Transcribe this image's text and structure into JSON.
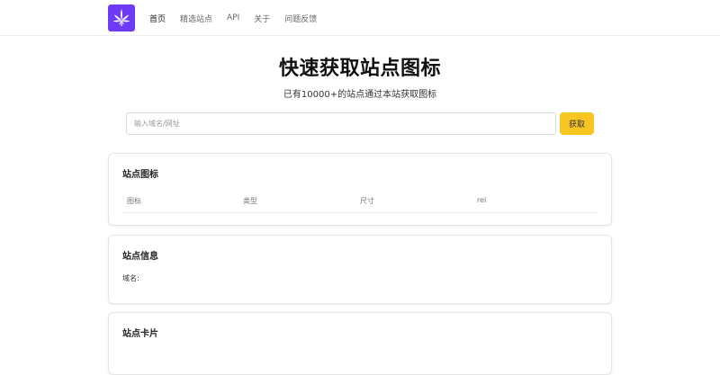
{
  "nav": {
    "logo_icon": "cannabis-leaf-icon",
    "logo_color": "#6d3bf5",
    "links": [
      "首页",
      "精选站点",
      "API",
      "关于",
      "问题反馈"
    ],
    "active_index": 0
  },
  "hero": {
    "title": "快速获取站点图标",
    "subtitle": "已有10000+的站点通过本站获取图标"
  },
  "search": {
    "placeholder": "输入域名/网址",
    "value": "",
    "button_label": "获取",
    "button_color": "#f7c623"
  },
  "icons_card": {
    "title": "站点图标",
    "columns": [
      "图标",
      "类型",
      "尺寸",
      "rel"
    ]
  },
  "info_card": {
    "title": "站点信息",
    "domain_label": "域名:"
  },
  "site_card": {
    "title": "站点卡片"
  }
}
